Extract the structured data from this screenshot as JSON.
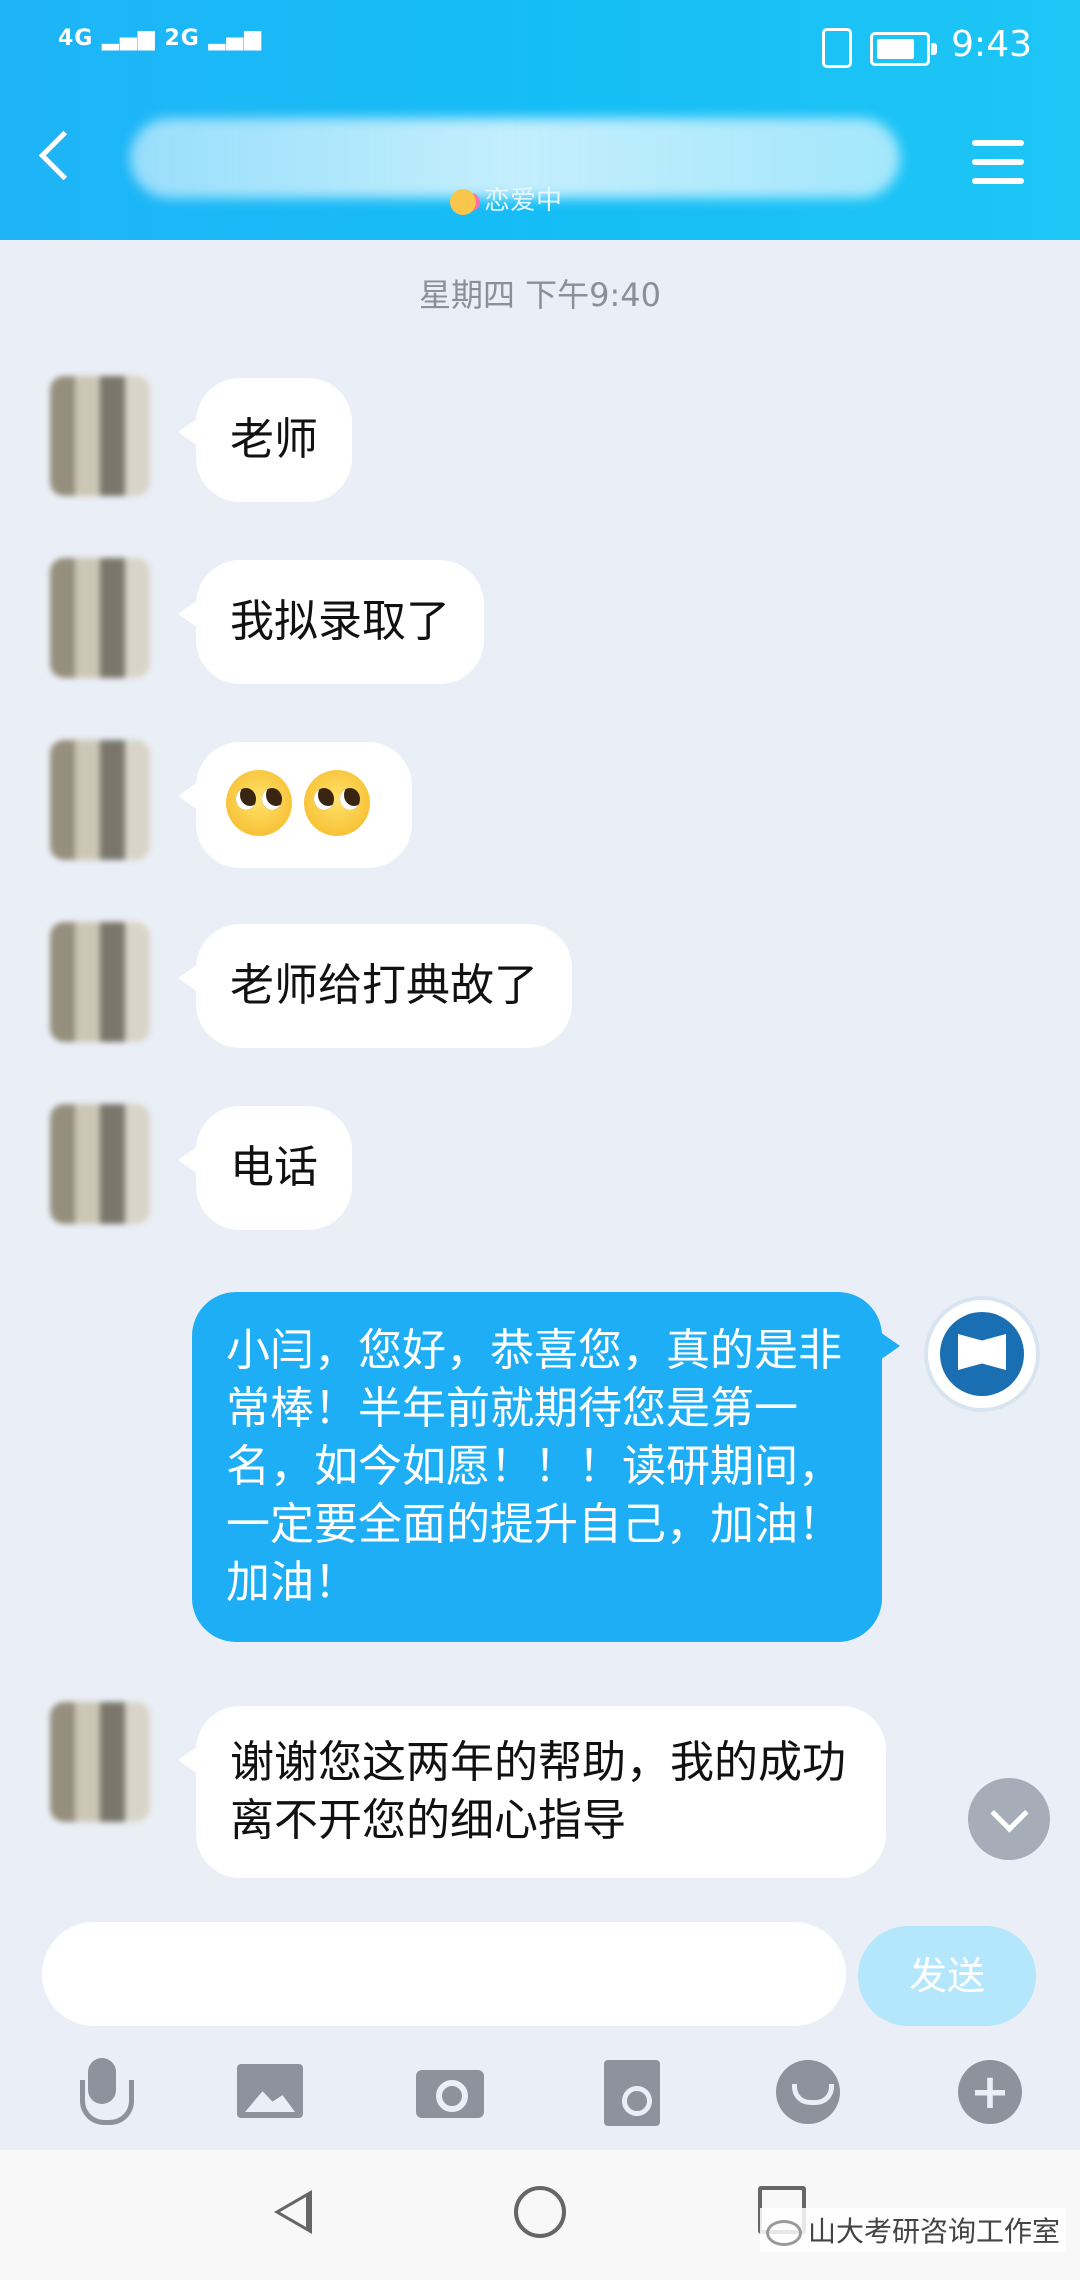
{
  "status_bar": {
    "signal": "4G ▂▄▆ 2G ▂▄▆",
    "time": "9:43",
    "battery_level": 0.8
  },
  "header": {
    "relation_label": "恋爱中"
  },
  "chat": {
    "timestamp": "星期四 下午9:40",
    "messages": [
      {
        "from": "other",
        "text": "老师"
      },
      {
        "from": "other",
        "text": "我拟录取了"
      },
      {
        "from": "other",
        "emoji_count": 2,
        "icon": "pleading-face-emoji"
      },
      {
        "from": "other",
        "text": "老师给打典故了"
      },
      {
        "from": "other",
        "text": "电话"
      },
      {
        "from": "me",
        "text": "小闫，您好，恭喜您，真的是非常棒！半年前就期待您是第一名，如今如愿！！！读研期间，一定要全面的提升自己，加油！加油！"
      },
      {
        "from": "other",
        "text": "谢谢您这两年的帮助，我的成功离不开您的细心指导"
      }
    ]
  },
  "composer": {
    "send_label": "发送"
  },
  "toolbar": {
    "icons": [
      "mic-icon",
      "image-icon",
      "camera-icon",
      "red-envelope-icon",
      "emoji-icon",
      "plus-icon"
    ]
  },
  "watermark": {
    "text": "山大考研咨询工作室"
  }
}
